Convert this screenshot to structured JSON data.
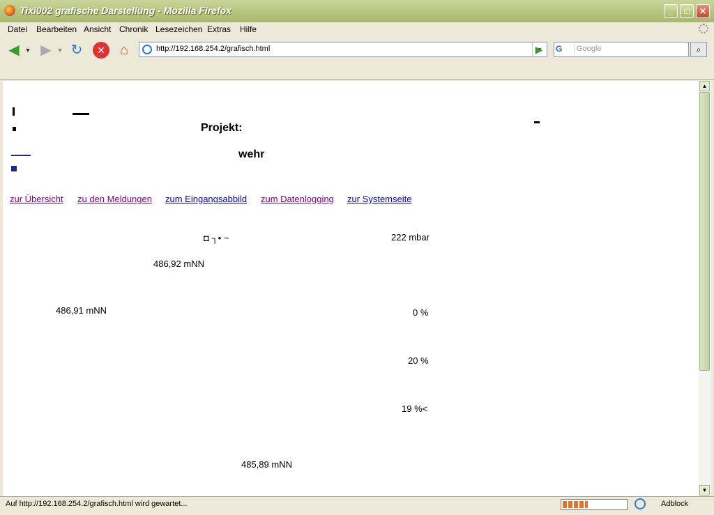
{
  "window": {
    "title": "Tixi002 grafische Darstellung - Mozilla Firefox"
  },
  "menubar": {
    "items": [
      "Datei",
      "Bearbeiten",
      "Ansicht",
      "Chronik",
      "Lesezeichen",
      "Extras",
      "Hilfe"
    ]
  },
  "navigation": {
    "url": "http://192.168.254.2/grafisch.html"
  },
  "search": {
    "engine": "G",
    "placeholder": "Google"
  },
  "page": {
    "project_label": "Projekt:",
    "fragment_text": "wehr",
    "links": [
      "zur Übersicht",
      "zu den Meldungen",
      "zum Eingangsabbild",
      "zum Datenlogging",
      "zur Systemseite"
    ],
    "symbol_row": "◘ ┐• ~",
    "values": {
      "pressure": "222 mbar",
      "level_1": "486,92 mNN",
      "level_2": "486,91 mNN",
      "percent_1": "0 %",
      "percent_2": "20 %",
      "percent_3": "19 %<",
      "level_3": "485,89 mNN"
    }
  },
  "statusbar": {
    "text": "Auf http://192.168.254.2/grafisch.html wird gewartet...",
    "progress": 0.4,
    "adblock": "Adblock"
  },
  "colors": {
    "link_visited": "#800080",
    "link_unvisited": "#0000cc"
  }
}
